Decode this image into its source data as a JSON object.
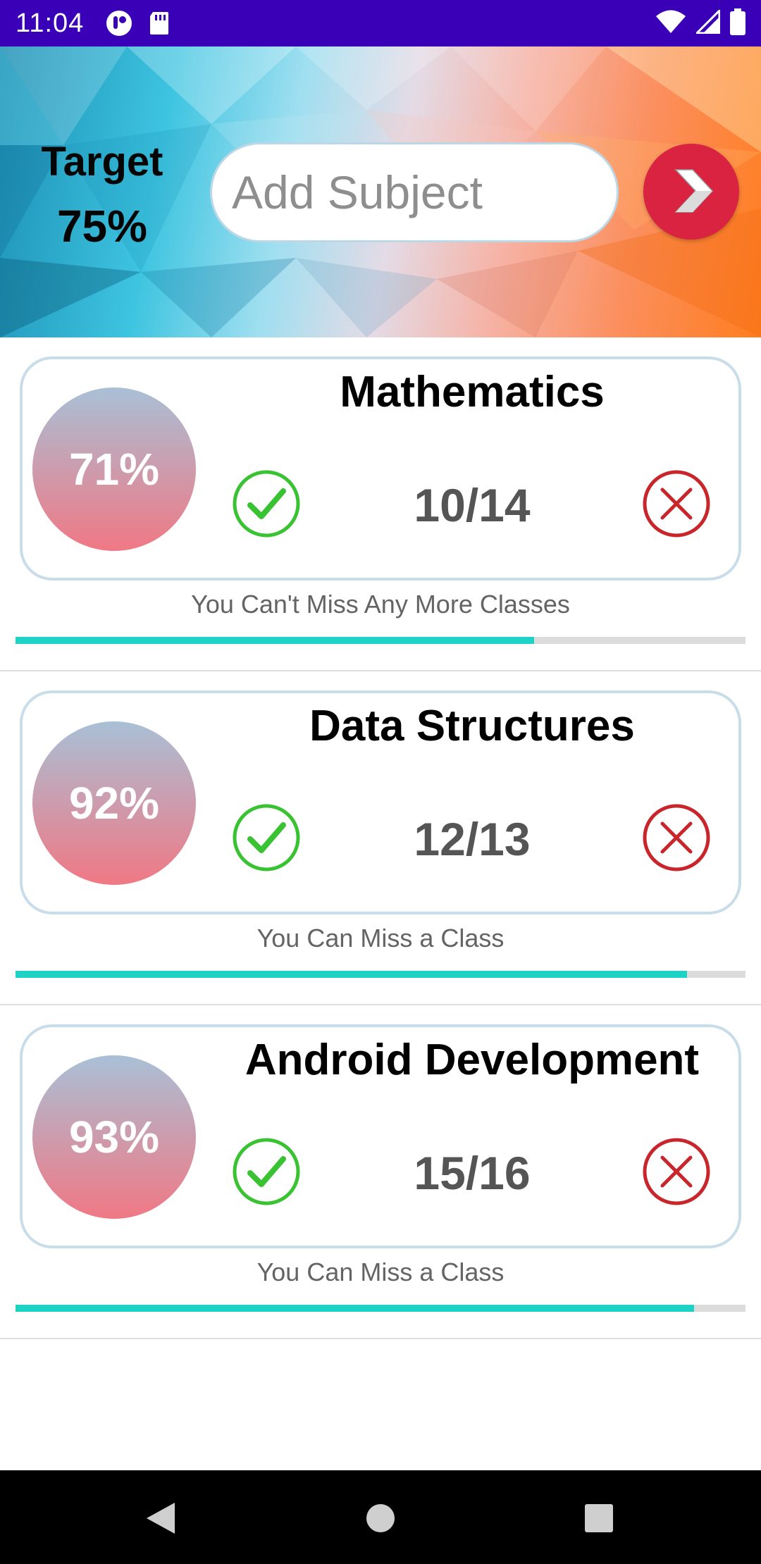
{
  "status_bar": {
    "time": "11:04",
    "left_icons": [
      "notification-app-icon",
      "sd-card-icon"
    ],
    "right_icons": [
      "wifi-icon",
      "cellular-signal-icon",
      "battery-icon"
    ]
  },
  "header": {
    "target_label": "Target",
    "target_value": "75%",
    "input_placeholder": "Add Subject",
    "submit_icon": "chevron-right-icon"
  },
  "subjects": [
    {
      "name": "Mathematics",
      "percent": "71%",
      "count": "10/14",
      "status": "You Can't Miss Any More Classes",
      "progress": 0.71
    },
    {
      "name": "Data Structures",
      "percent": "92%",
      "count": "12/13",
      "status": "You Can Miss a Class",
      "progress": 0.92
    },
    {
      "name": "Android Development",
      "percent": "93%",
      "count": "15/16",
      "status": "You Can Miss a Class",
      "progress": 0.93
    }
  ],
  "colors": {
    "status_bar": "#3a00b8",
    "present": "#39c231",
    "absent": "#c9262b",
    "progress": "#1ed3c5",
    "go_button": "#d92340"
  },
  "nav_bar": {
    "icons": [
      "back-icon",
      "home-icon",
      "recents-icon"
    ]
  }
}
